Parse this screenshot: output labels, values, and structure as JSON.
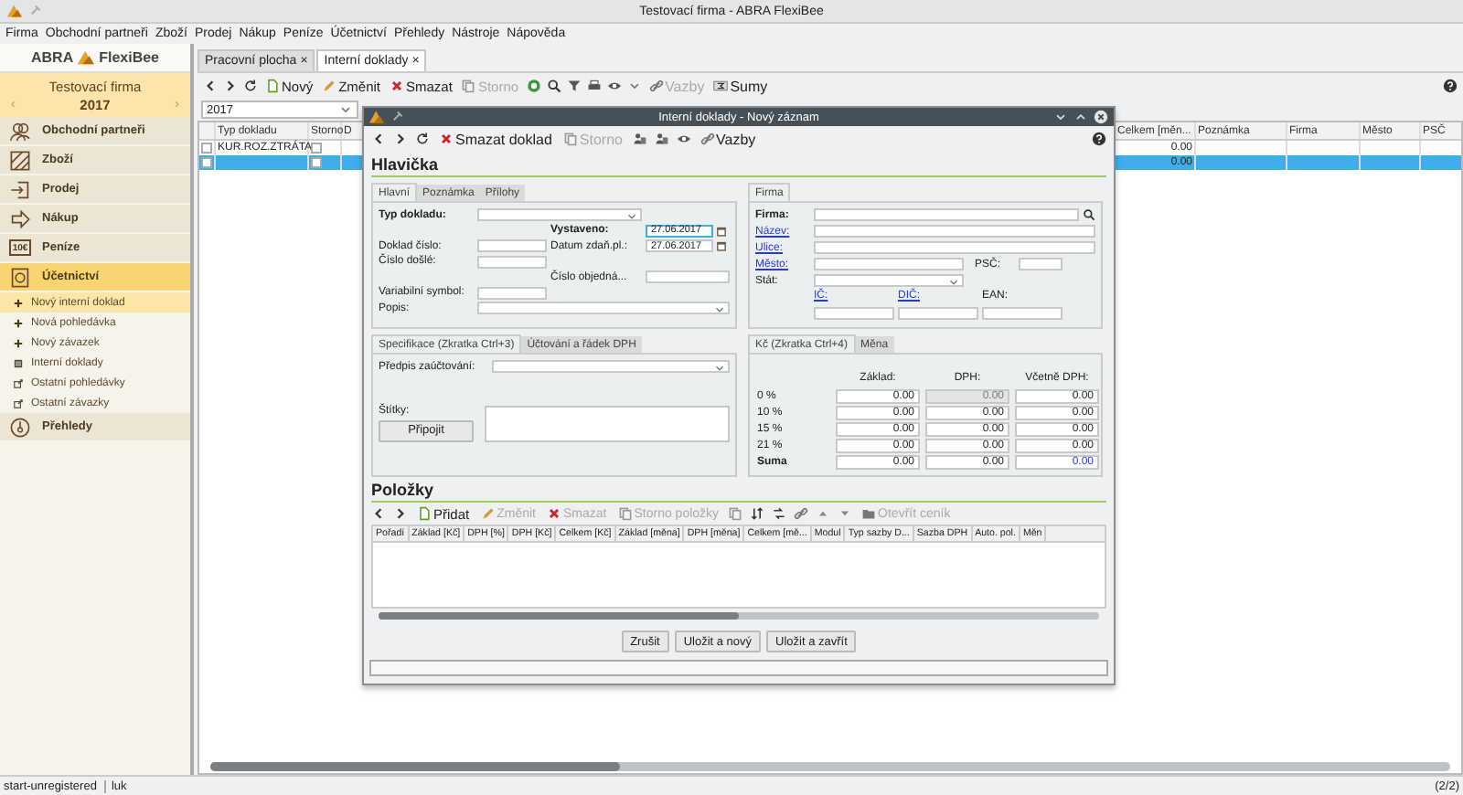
{
  "window": {
    "title": "Testovací firma - ABRA FlexiBee"
  },
  "menu": [
    "Firma",
    "Obchodní partneři",
    "Zboží",
    "Prodej",
    "Nákup",
    "Peníze",
    "Účetnictví",
    "Přehledy",
    "Nástroje",
    "Nápověda"
  ],
  "sidebar": {
    "logo": [
      "ABRA",
      "FlexiBee"
    ],
    "company": "Testovací firma",
    "year": "2017",
    "prev": "‹",
    "next": "›",
    "sections": [
      {
        "label": "Obchodní partneři",
        "selected": false
      },
      {
        "label": "Zboží",
        "selected": false
      },
      {
        "label": "Prodej",
        "selected": false
      },
      {
        "label": "Nákup",
        "selected": false
      },
      {
        "label": "Peníze",
        "selected": false,
        "badge": "10€"
      },
      {
        "label": "Účetnictví",
        "selected": true,
        "children": [
          {
            "label": "Nový interní doklad",
            "selected": true
          },
          {
            "label": "Nová pohledávka",
            "selected": false
          },
          {
            "label": "Nový závazek",
            "selected": false
          },
          {
            "label": "Interní doklady",
            "selected": false
          },
          {
            "label": "Ostatní pohledávky",
            "selected": false
          },
          {
            "label": "Ostatní závazky",
            "selected": false
          }
        ]
      },
      {
        "label": "Přehledy",
        "selected": false
      }
    ]
  },
  "tabs": [
    {
      "label": "Pracovní plocha",
      "close": "×",
      "selected": false
    },
    {
      "label": "Interní doklady",
      "close": "×",
      "selected": true
    }
  ],
  "toolbar": {
    "actions": [
      {
        "label": "Nový",
        "disabled": false
      },
      {
        "label": "Změnit",
        "disabled": false
      },
      {
        "label": "Smazat",
        "disabled": false
      },
      {
        "label": "Storno",
        "disabled": true
      }
    ],
    "links": [
      {
        "label": "Vazby",
        "disabled": true
      },
      {
        "label": "Sumy",
        "disabled": false
      }
    ]
  },
  "filter": {
    "year": "2017"
  },
  "table": {
    "columns_left": [
      "Typ dokladu",
      "Storno",
      "D"
    ],
    "columns_right": [
      "Celkem [měn...",
      "Poznámka",
      "Firma",
      "Město",
      "PSČ"
    ],
    "rows": [
      {
        "selected": false,
        "storno": false,
        "type": "KUR.ROZ.ZTRÁTA",
        "total": "0.00"
      },
      {
        "selected": true,
        "storno": false,
        "type": "",
        "total": "0.00"
      }
    ]
  },
  "dialog": {
    "title": "Interní doklady - Nový záznam",
    "actions": [
      {
        "label": "Smazat doklad",
        "disabled": false
      },
      {
        "label": "Storno",
        "disabled": true
      }
    ],
    "link": {
      "label": "Vazby",
      "disabled": false
    },
    "header_title": "Hlavička",
    "main_tabs": [
      {
        "label": "Hlavní",
        "selected": true
      },
      {
        "label": "Poznámka",
        "selected": false
      },
      {
        "label": "Přílohy",
        "selected": false
      }
    ],
    "form": {
      "type_label": "Typ dokladu:",
      "issued_label": "Vystaveno:",
      "issued": "27.06.2017",
      "number_label": "Doklad číslo:",
      "tax_date_label": "Datum zdaň.pl.:",
      "tax_date": "27.06.2017",
      "received_label": "Číslo došlé:",
      "order_label": "Číslo objedná...",
      "vs_label": "Variabilní symbol:",
      "desc_label": "Popis:"
    },
    "firm_tabs": [
      {
        "label": "Firma",
        "selected": true
      }
    ],
    "firm": {
      "firm_label": "Firma:",
      "name_label": "Název:",
      "street_label": "Ulice:",
      "city_label": "Město:",
      "zip_label": "PSČ:",
      "country_label": "Stát:",
      "ic_label": "IČ:",
      "dic_label": "DIČ:",
      "ean_label": "EAN:"
    },
    "spec_tabs": [
      {
        "label": "Specifikace (Zkratka Ctrl+3)",
        "selected": true
      },
      {
        "label": "Účtování a řádek DPH",
        "selected": false
      }
    ],
    "spec": {
      "rule_label": "Předpis zaúčtování:",
      "tags_label": "Štítky:",
      "attach": "Připojit"
    },
    "vat_tabs": [
      {
        "label": "Kč (Zkratka Ctrl+4)",
        "selected": true
      },
      {
        "label": "Měna",
        "selected": false
      }
    ],
    "vat_columns": [
      "Základ:",
      "DPH:",
      "Včetně DPH:"
    ],
    "vat_rows": [
      {
        "kind": "rate",
        "label": "0 %",
        "base": "0.00",
        "vat": "0.00",
        "total": "0.00",
        "vat_disabled": true
      },
      {
        "kind": "rate",
        "label": "10 %",
        "base": "0.00",
        "vat": "0.00",
        "total": "0.00",
        "vat_disabled": false
      },
      {
        "kind": "rate",
        "label": "15 %",
        "base": "0.00",
        "vat": "0.00",
        "total": "0.00",
        "vat_disabled": false
      },
      {
        "kind": "rate",
        "label": "21 %",
        "base": "0.00",
        "vat": "0.00",
        "total": "0.00",
        "vat_disabled": false
      },
      {
        "kind": "sum",
        "label": "Suma",
        "base": "0.00",
        "vat": "0.00",
        "total": "0.00",
        "vat_disabled": false
      }
    ],
    "items_title": "Položky",
    "items_actions": [
      {
        "label": "Přidat",
        "disabled": false
      },
      {
        "label": "Změnit",
        "disabled": true
      },
      {
        "label": "Smazat",
        "disabled": true
      },
      {
        "label": "Storno položky",
        "disabled": true
      }
    ],
    "pricelist": {
      "label": "Otevřít ceník",
      "disabled": true
    },
    "items_columns": [
      "Pořadí",
      "Základ [Kč]",
      "DPH [%]",
      "DPH [Kč]",
      "Celkem [Kč]",
      "Základ [měna]",
      "DPH [měna]",
      "Celkem [mě...",
      "Modul",
      "Typ sazby D...",
      "Sazba DPH",
      "Auto. pol.",
      "Měn"
    ],
    "buttons": [
      "Zrušit",
      "Uložit a nový",
      "Uložit a zavřít"
    ]
  },
  "status_bar": {
    "user_mode": "start-unregistered",
    "user": "luk",
    "count": "(2/2)"
  }
}
